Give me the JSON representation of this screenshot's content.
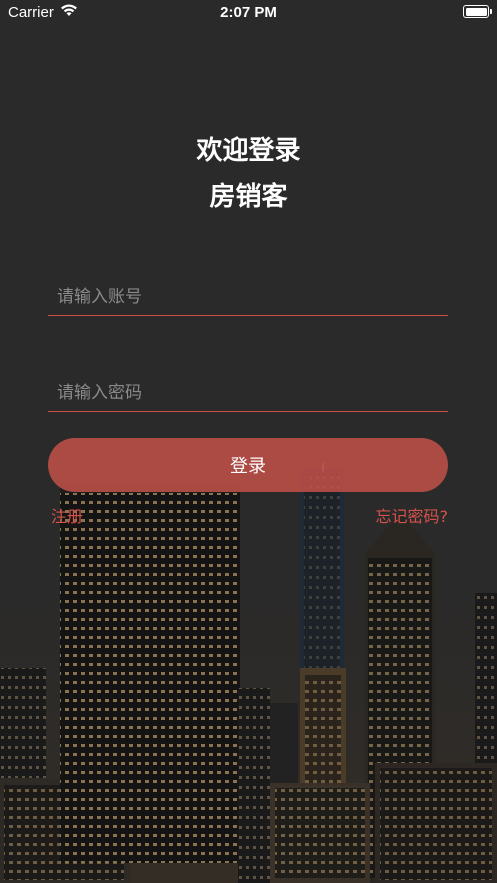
{
  "status_bar": {
    "carrier": "Carrier",
    "time": "2:07 PM"
  },
  "header": {
    "line1": "欢迎登录",
    "line2": "房销客"
  },
  "form": {
    "account_placeholder": "请输入账号",
    "password_placeholder": "请输入密码",
    "login_label": "登录"
  },
  "links": {
    "register": "注册",
    "forgot_password": "忘记密码?"
  },
  "colors": {
    "accent": "#c9524a",
    "link": "#d4534a",
    "background": "#2a2a2a"
  },
  "icons": [
    "wifi-icon",
    "battery-icon"
  ]
}
